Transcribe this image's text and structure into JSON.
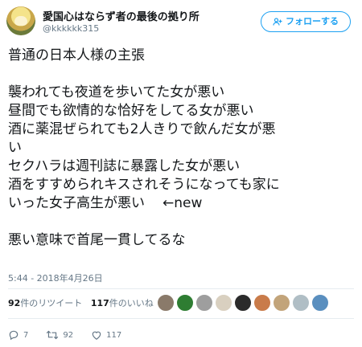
{
  "user": {
    "display_name": "愛国心はならず者の最後の拠り所",
    "screen_name": "@kkkkkk315",
    "follow_label": "フォローする",
    "avatar_icon": "anime-character-avatar"
  },
  "tweet": {
    "lines": [
      "普通の日本人様の主張",
      "",
      "襲われても夜道を歩いてた女が悪い",
      "昼間でも欲情的な恰好をしてる女が悪い",
      "酒に薬混ぜられても2人きりで飲んだ女が悪",
      "い",
      "セクハラは週刊誌に暴露した女が悪い",
      "酒をすすめられキスされそうになっても家に",
      "いった女子高生が悪い",
      "",
      "悪い意味で首尾一貫してるな"
    ],
    "arrow_note": "←new"
  },
  "timestamp": "5:44 - 2018年4月26日",
  "stats": {
    "retweet_count": "92",
    "retweet_label": "件のリツイート",
    "like_count": "117",
    "like_label": "件のいいね"
  },
  "likers": [
    {
      "icon": "liker-avatar-1",
      "color": "#8a7a6a"
    },
    {
      "icon": "liker-avatar-2",
      "color": "#2e7d32"
    },
    {
      "icon": "liker-avatar-3",
      "color": "#9e9e9e"
    },
    {
      "icon": "liker-avatar-4",
      "color": "#d9d0c0"
    },
    {
      "icon": "liker-avatar-5",
      "color": "#2b2b2b"
    },
    {
      "icon": "liker-avatar-6",
      "color": "#c97b4a"
    },
    {
      "icon": "liker-avatar-7",
      "color": "#c2a47a"
    },
    {
      "icon": "liker-avatar-8",
      "color": "#b0bec5"
    },
    {
      "icon": "liker-avatar-9",
      "color": "#5a8fbf"
    }
  ],
  "actions": {
    "reply_count": "7",
    "retweet_count": "92",
    "like_count": "117"
  },
  "colors": {
    "accent": "#1da1f2",
    "text": "#14171a",
    "muted": "#657786"
  }
}
